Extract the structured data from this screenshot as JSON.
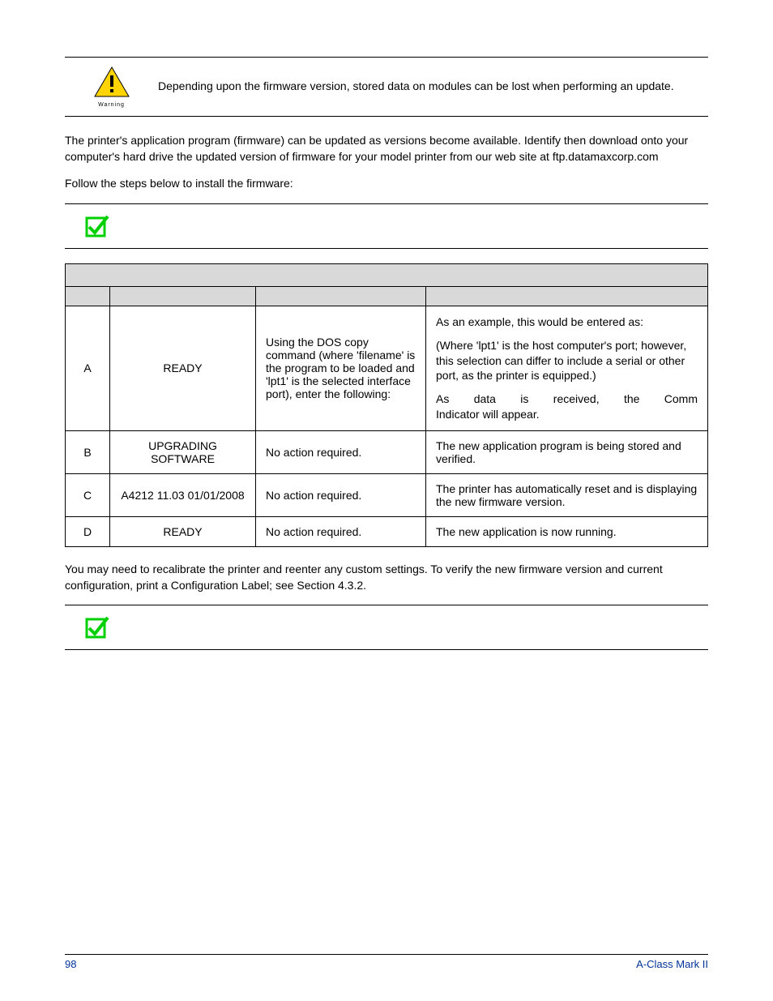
{
  "warning": {
    "label": "Warning",
    "text": "Depending upon the firmware version, stored data on modules can be lost when performing an update."
  },
  "para1": "The printer's application program (firmware) can be updated as versions become available. Identify then download onto your computer's hard drive the updated version of firmware for your model printer from our web site at ftp.datamaxcorp.com",
  "para2": "Follow the steps below to install the firmware:",
  "steps": [
    {
      "step": "A",
      "display": "READY",
      "action": "Using the DOS copy command (where 'filename' is the program to be loaded and 'lpt1' is the selected interface port), enter the following:",
      "comments": {
        "p1": "As an example, this would be entered as:",
        "p2": "(Where 'lpt1' is the host computer's port; however, this selection can differ to include a serial or other port, as the printer is equipped.)",
        "p3a": "As data is received, the Comm",
        "p3b": "Indicator will appear."
      }
    },
    {
      "step": "B",
      "display": "UPGRADING SOFTWARE",
      "action": "No action required.",
      "comments_single": "The new application program is being stored and verified."
    },
    {
      "step": "C",
      "display": "A4212 11.03 01/01/2008",
      "action": "No action required.",
      "comments_single": "The printer has automatically reset and is displaying the new firmware version."
    },
    {
      "step": "D",
      "display": "READY",
      "action": "No action required.",
      "comments_single": "The new application is now running."
    }
  ],
  "para3": "You may need to recalibrate the printer and reenter any custom settings. To verify the new firmware version and current configuration, print a Configuration Label; see Section 4.3.2.",
  "footer": {
    "page": "98",
    "title": "A-Class Mark II"
  }
}
